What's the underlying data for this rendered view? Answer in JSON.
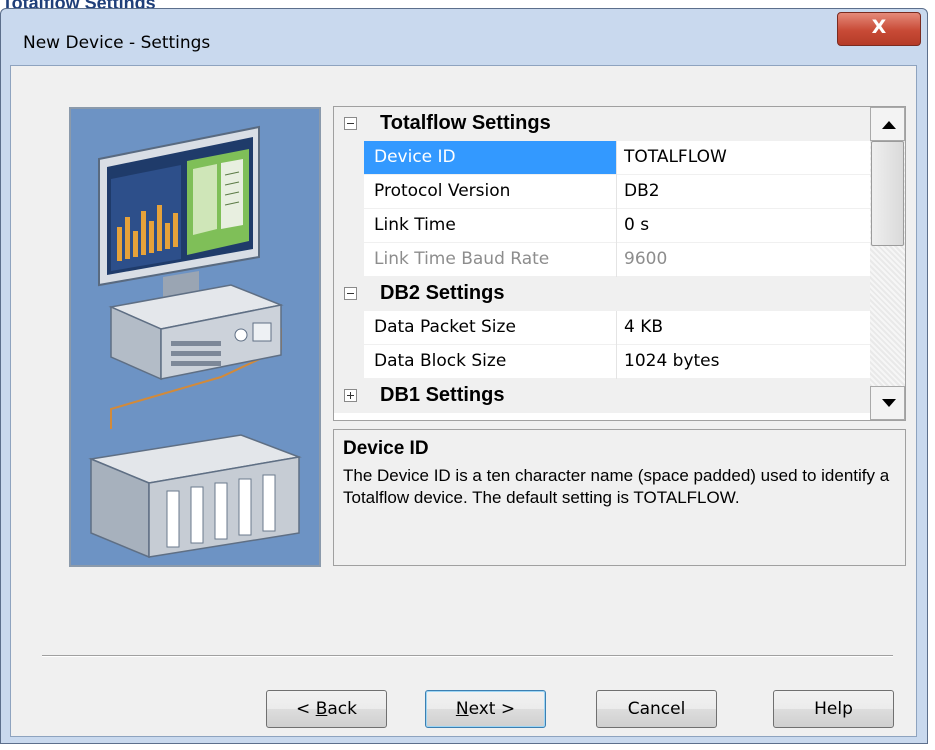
{
  "page_heading": "Totalflow Settings",
  "window": {
    "title": "New Device - Settings",
    "close_glyph": "X"
  },
  "property_grid": {
    "rows": [
      {
        "type": "category",
        "name": "Totalflow Settings",
        "toggle": "collapse"
      },
      {
        "type": "property",
        "name": "Device ID",
        "value": "TOTALFLOW",
        "selected": true
      },
      {
        "type": "property",
        "name": "Protocol Version",
        "value": "DB2"
      },
      {
        "type": "property",
        "name": "Link Time",
        "value": "0 s"
      },
      {
        "type": "property",
        "name": "Link Time Baud Rate",
        "value": "9600",
        "disabled": true
      },
      {
        "type": "category",
        "name": "DB2 Settings",
        "toggle": "collapse"
      },
      {
        "type": "property",
        "name": "Data Packet Size",
        "value": "4 KB"
      },
      {
        "type": "property",
        "name": "Data Block Size",
        "value": "1024 bytes"
      },
      {
        "type": "category",
        "name": "DB1 Settings",
        "toggle": "expand"
      }
    ]
  },
  "description": {
    "title": "Device ID",
    "body": "The Device ID is a ten character name (space padded) used to identify a Totalflow device. The default setting is TOTALFLOW."
  },
  "buttons": {
    "back": {
      "prefix": "< ",
      "mnemonic": "B",
      "rest": "ack"
    },
    "next": {
      "mnemonic": "N",
      "rest": "ext >"
    },
    "cancel": "Cancel",
    "help": "Help"
  },
  "colors": {
    "selection": "#3399ff",
    "art_background": "#6d93c4",
    "close_button": "#c84a36"
  },
  "icons": {
    "close": "close-icon",
    "collapse": "minus-box-icon",
    "expand": "plus-box-icon",
    "illustration": "computer-and-plc-illustration"
  }
}
